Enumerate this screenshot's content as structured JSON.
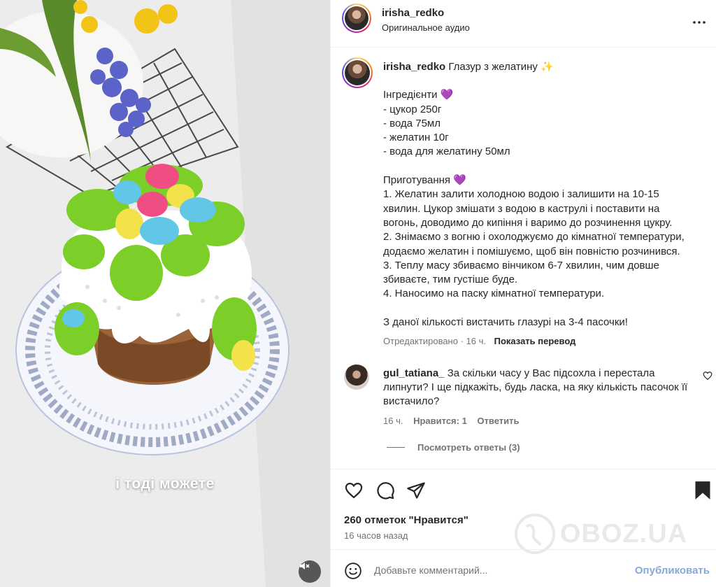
{
  "media": {
    "caption": "і тоді можете",
    "mute_icon": "speaker-muted-icon"
  },
  "header": {
    "username": "irisha_redko",
    "audio": "Оригинальное аудио",
    "more_icon": "more-horizontal-icon"
  },
  "post": {
    "username": "irisha_redko",
    "title": "Глазур з желатину ✨",
    "lines": [
      "Інгредієнти 💜",
      "- цукор 250г",
      "- вода 75мл",
      "- желатин 10г",
      "- вода для желатину 50мл",
      "",
      "Приготування 💜",
      "1. Желатин залити холодною водою і залишити на 10-15",
      "хвилин. Цукор змішати з водою в каструлі і поставити на",
      "вогонь, доводимо до кипіння і варимо до розчинення цукру.",
      "2. Знімаємо з вогню і охолоджуємо до кімнатної температури,",
      "додаємо желатин і помішуємо, щоб він повністю розчинився.",
      "3. Теплу масу збиваємо вінчиком 6-7 хвилин, чим довше",
      "збиваєте, тим густіше буде.",
      "4. Наносимо на паску кімнатної температури.",
      "",
      "З даної кількості вистачить глазурі на 3-4 пасочки!"
    ],
    "edited": "Отредактировано · 16 ч.",
    "translate": "Показать перевод"
  },
  "comment": {
    "username": "gul_tatiana_",
    "text": "За скільки часу у Вас підсохла і перестала липнути? І ще підкажіть, будь ласка, на яку кількість пасочок її вистачило?",
    "time": "16 ч.",
    "likes": "Нравится: 1",
    "reply": "Ответить",
    "view_replies": "Посмотреть ответы (3)"
  },
  "actions": {
    "likes": "260 отметок \"Нравится\"",
    "time": "16 часов назад"
  },
  "watermark": {
    "text": "OBOZ.UA"
  },
  "composer": {
    "placeholder": "Добавьте комментарий...",
    "publish": "Опубликовать"
  }
}
